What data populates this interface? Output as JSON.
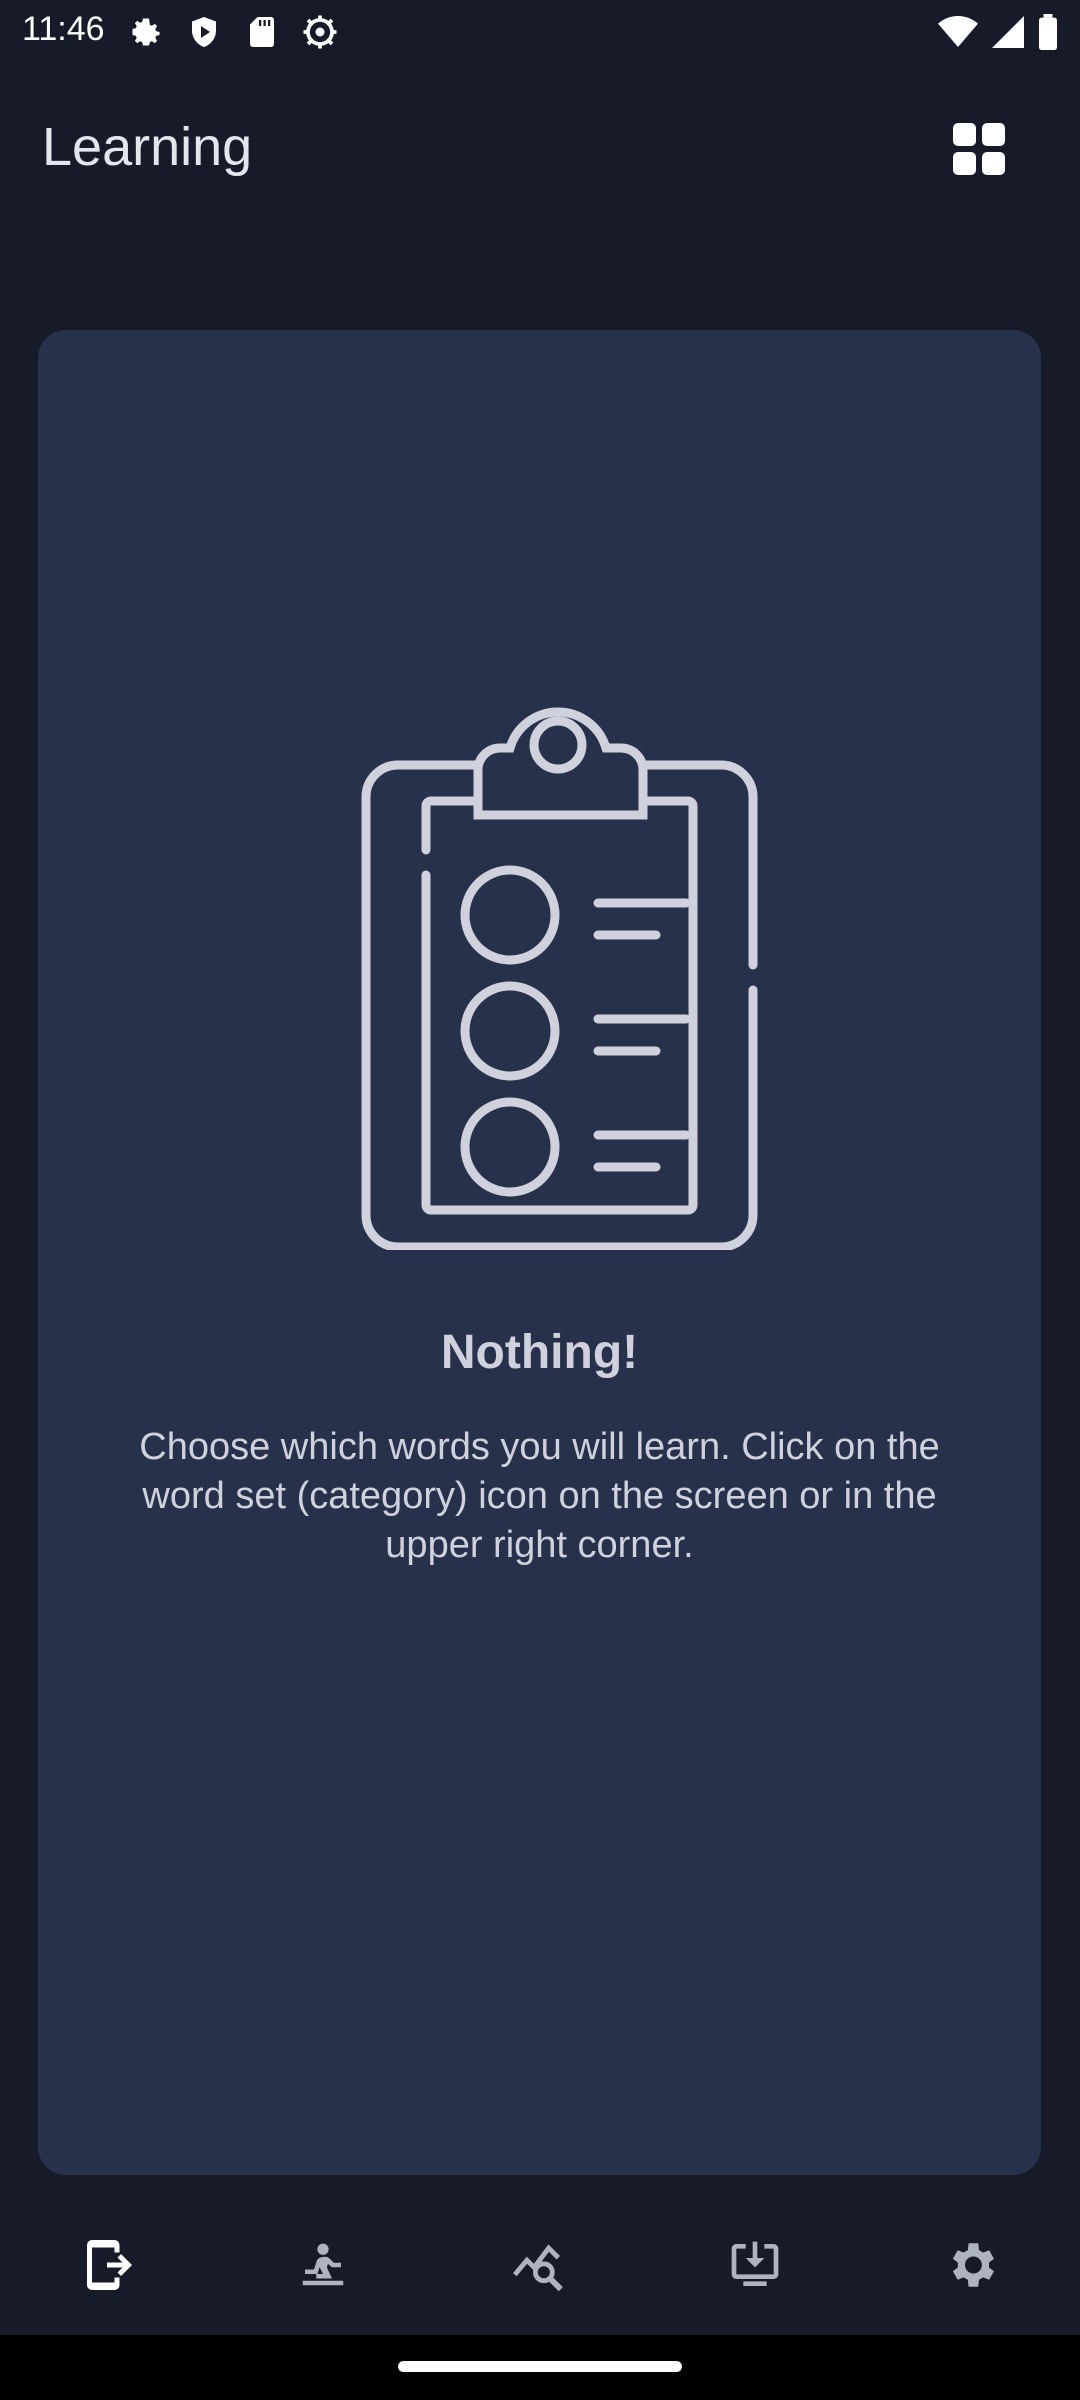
{
  "status_bar": {
    "time": "11:46",
    "left_icons": [
      "settings-icon",
      "shield-icon",
      "sd-card-icon",
      "gear-badge-icon"
    ],
    "right_icons": [
      "wifi-icon",
      "signal-icon",
      "battery-icon"
    ]
  },
  "app_bar": {
    "title": "Learning",
    "category_icon": "grid-icon"
  },
  "empty_state": {
    "illustration": "clipboard-checklist-icon",
    "title": "Nothing!",
    "description": "Choose which words you will learn. Click on the word set (category) icon on the screen or in the upper right corner."
  },
  "bottom_nav": {
    "items": [
      {
        "icon": "learning-icon",
        "active": true
      },
      {
        "icon": "practice-icon",
        "active": false
      },
      {
        "icon": "statistics-icon",
        "active": false
      },
      {
        "icon": "download-icon",
        "active": false
      },
      {
        "icon": "settings-icon",
        "active": false
      }
    ]
  },
  "colors": {
    "background": "#171b29",
    "card": "#28314b",
    "text": "#cfd2dc",
    "icon_active": "#ffffff",
    "icon_inactive": "#aeb3c2"
  }
}
